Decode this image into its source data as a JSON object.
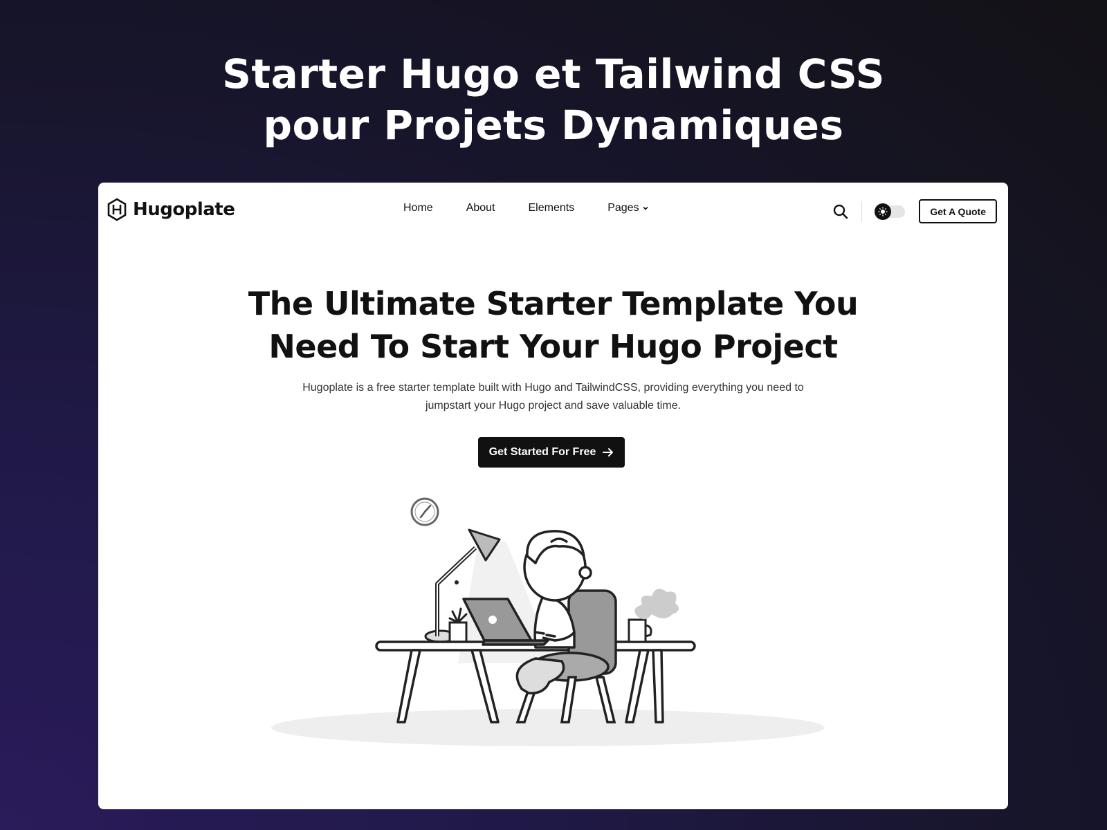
{
  "banner": {
    "line1": "Starter Hugo et Tailwind CSS",
    "line2": "pour Projets Dynamiques"
  },
  "header": {
    "logo_text": "Hugoplate",
    "logo_icon": "hexagon-h-icon",
    "nav": [
      {
        "label": "Home"
      },
      {
        "label": "About"
      },
      {
        "label": "Elements"
      },
      {
        "label": "Pages",
        "has_dropdown": true
      }
    ],
    "search_icon": "search-icon",
    "theme_toggle_icon": "sun-icon",
    "quote_button": "Get A Quote"
  },
  "hero": {
    "title_line1": "The Ultimate Starter Template You",
    "title_line2": "Need To Start Your Hugo Project",
    "description": "Hugoplate is a free starter template built with Hugo and TailwindCSS, providing everything you need to jumpstart your Hugo project and save valuable time.",
    "cta_label": "Get Started For Free",
    "cta_icon": "arrow-right-icon"
  },
  "colors": {
    "background_dark": "#17152b",
    "background_purple": "#2a1b5a",
    "primary": "#111111",
    "text_body": "#333333"
  }
}
